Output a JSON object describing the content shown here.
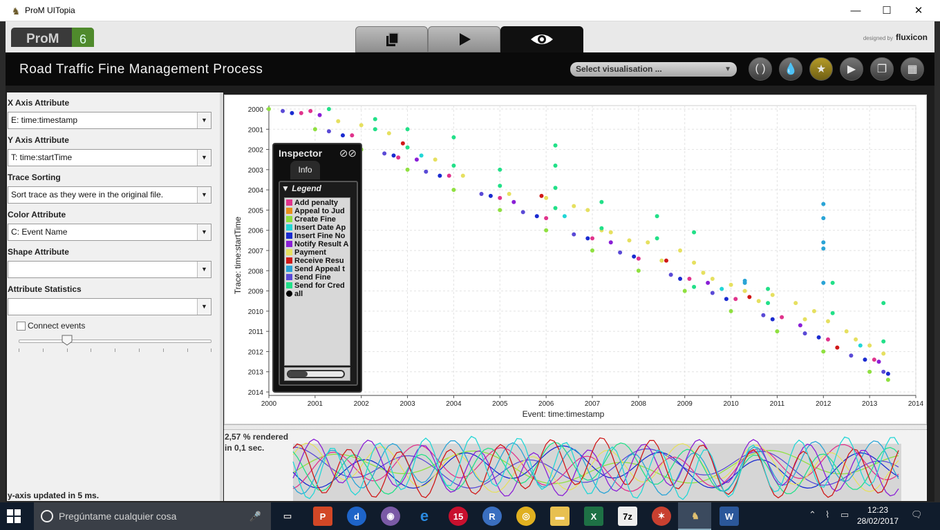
{
  "window": {
    "title": "ProM UITopia",
    "minimize": "—",
    "maximize": "☐",
    "close": "✕"
  },
  "header": {
    "logo_text": "ProM",
    "logo_version": "6",
    "designed_by": "designed by",
    "brand": "fluxicon",
    "tabs": [
      {
        "name": "workspace",
        "icon": "copy-icon",
        "active": false
      },
      {
        "name": "actions",
        "icon": "play-icon",
        "active": false
      },
      {
        "name": "view",
        "icon": "eye-icon",
        "active": true
      }
    ]
  },
  "toolbar": {
    "process_title": "Road Traffic Fine Management Process",
    "visualisation_select": "Select visualisation ...",
    "buttons": [
      {
        "icon": "refresh-icon",
        "active": false
      },
      {
        "icon": "drop-icon",
        "active": false
      },
      {
        "icon": "star-icon",
        "active": true
      },
      {
        "icon": "play-icon",
        "active": false
      },
      {
        "icon": "copy-icon",
        "active": false
      },
      {
        "icon": "grid-icon",
        "active": false
      }
    ]
  },
  "left_panel": {
    "x_axis_label": "X Axis Attribute",
    "x_axis_value": "E: time:timestamp",
    "y_axis_label": "Y Axis Attribute",
    "y_axis_value": "T: time:startTime",
    "trace_sorting_label": "Trace Sorting",
    "trace_sorting_value": "Sort trace as they were in the original file.",
    "color_label": "Color Attribute",
    "color_value": "C: Event Name",
    "shape_label": "Shape Attribute",
    "shape_value": "",
    "stats_label": "Attribute Statistics",
    "stats_value": "",
    "connect_events_label": "Connect events",
    "connect_events_checked": false,
    "slider_level": 0.25,
    "status": "y-axis updated in 5 ms."
  },
  "overview": {
    "rendered_pct": "2,57 % rendered",
    "rendered_time": "in 0,1 sec."
  },
  "inspector": {
    "title": "Inspector",
    "tab": "Info",
    "legend_title": "Legend",
    "legend_items": [
      {
        "label": "Add penalty",
        "color": "#e0338c"
      },
      {
        "label": "Appeal to Jud",
        "color": "#e8901a"
      },
      {
        "label": "Create Fine",
        "color": "#8fe040"
      },
      {
        "label": "Insert Date Ap",
        "color": "#22d6d6"
      },
      {
        "label": "Insert Fine No",
        "color": "#1a2bd0"
      },
      {
        "label": "Notify Result A",
        "color": "#8a1fd6"
      },
      {
        "label": "Payment",
        "color": "#e6e060"
      },
      {
        "label": "Receive Resu",
        "color": "#d01818"
      },
      {
        "label": "Send Appeal t",
        "color": "#2aa4d6"
      },
      {
        "label": "Send Fine",
        "color": "#5a4ad6"
      },
      {
        "label": "Send for Cred",
        "color": "#22e088"
      },
      {
        "label": "all",
        "color": "#000000",
        "round": true
      }
    ],
    "scroll_position": 0.33
  },
  "chart_data": {
    "type": "scatter",
    "title": "",
    "xlabel": "Event: time:timestamp",
    "ylabel": "Trace: time:startTime",
    "x_ticks": [
      "2000",
      "2001",
      "2002",
      "2003",
      "2004",
      "2005",
      "2006",
      "2007",
      "2008",
      "2009",
      "2010",
      "2011",
      "2012",
      "2013",
      "2014"
    ],
    "y_ticks": [
      "2000",
      "2001",
      "2002",
      "2003",
      "2004",
      "2005",
      "2006",
      "2007",
      "2008",
      "2009",
      "2010",
      "2011",
      "2012",
      "2013",
      "2014"
    ],
    "xlim": [
      2000,
      2014
    ],
    "ylim": [
      2000,
      2014
    ],
    "y_inverted": true,
    "grid": true,
    "series": [
      {
        "name": "Create Fine",
        "color": "#8fe040",
        "points": [
          [
            2000.0,
            2000.0
          ],
          [
            2001.0,
            2001.0
          ],
          [
            2002.0,
            2002.0
          ],
          [
            2003.0,
            2003.0
          ],
          [
            2004.0,
            2004.0
          ],
          [
            2005.0,
            2005.0
          ],
          [
            2006.0,
            2006.0
          ],
          [
            2007.0,
            2007.0
          ],
          [
            2008.0,
            2008.0
          ],
          [
            2009.0,
            2009.0
          ],
          [
            2010.0,
            2010.0
          ],
          [
            2011.0,
            2011.0
          ],
          [
            2012.0,
            2012.0
          ],
          [
            2013.0,
            2013.0
          ],
          [
            2013.4,
            2013.4
          ]
        ]
      },
      {
        "name": "Send Fine",
        "color": "#5a4ad6",
        "points": [
          [
            2000.3,
            2000.1
          ],
          [
            2001.3,
            2001.1
          ],
          [
            2002.5,
            2002.2
          ],
          [
            2003.4,
            2003.1
          ],
          [
            2004.6,
            2004.2
          ],
          [
            2005.5,
            2005.1
          ],
          [
            2006.6,
            2006.2
          ],
          [
            2007.6,
            2007.1
          ],
          [
            2008.7,
            2008.2
          ],
          [
            2009.6,
            2009.1
          ],
          [
            2010.7,
            2010.2
          ],
          [
            2011.6,
            2011.1
          ],
          [
            2012.6,
            2012.2
          ],
          [
            2013.3,
            2013.0
          ]
        ]
      },
      {
        "name": "Insert Fine Notification",
        "color": "#1a2bd0",
        "points": [
          [
            2000.5,
            2000.2
          ],
          [
            2001.6,
            2001.3
          ],
          [
            2002.7,
            2002.3
          ],
          [
            2003.7,
            2003.3
          ],
          [
            2004.8,
            2004.3
          ],
          [
            2005.8,
            2005.3
          ],
          [
            2006.9,
            2006.4
          ],
          [
            2007.9,
            2007.3
          ],
          [
            2008.9,
            2008.4
          ],
          [
            2009.9,
            2009.4
          ],
          [
            2010.9,
            2010.4
          ],
          [
            2011.9,
            2011.3
          ],
          [
            2012.9,
            2012.4
          ],
          [
            2013.4,
            2013.1
          ]
        ]
      },
      {
        "name": "Add penalty",
        "color": "#e0338c",
        "points": [
          [
            2000.7,
            2000.2
          ],
          [
            2001.8,
            2001.3
          ],
          [
            2002.8,
            2002.4
          ],
          [
            2003.9,
            2003.3
          ],
          [
            2005.0,
            2004.4
          ],
          [
            2006.0,
            2005.4
          ],
          [
            2007.0,
            2006.4
          ],
          [
            2008.0,
            2007.4
          ],
          [
            2009.1,
            2008.4
          ],
          [
            2010.1,
            2009.4
          ],
          [
            2011.1,
            2010.3
          ],
          [
            2012.1,
            2011.4
          ],
          [
            2013.1,
            2012.4
          ],
          [
            2000.9,
            2000.1
          ]
        ]
      },
      {
        "name": "Payment",
        "color": "#e6e060",
        "points": [
          [
            2001.5,
            2000.6
          ],
          [
            2002.0,
            2000.8
          ],
          [
            2002.6,
            2001.2
          ],
          [
            2003.6,
            2002.5
          ],
          [
            2004.2,
            2003.3
          ],
          [
            2005.2,
            2004.2
          ],
          [
            2006.0,
            2004.4
          ],
          [
            2006.6,
            2004.8
          ],
          [
            2006.9,
            2005.0
          ],
          [
            2007.4,
            2006.1
          ],
          [
            2007.8,
            2006.5
          ],
          [
            2008.2,
            2006.6
          ],
          [
            2008.9,
            2007.0
          ],
          [
            2009.2,
            2007.6
          ],
          [
            2009.6,
            2008.4
          ],
          [
            2010.0,
            2008.7
          ],
          [
            2010.3,
            2009.0
          ],
          [
            2010.9,
            2009.2
          ],
          [
            2011.4,
            2009.6
          ],
          [
            2011.8,
            2010.0
          ],
          [
            2012.1,
            2010.5
          ],
          [
            2012.7,
            2011.4
          ],
          [
            2013.0,
            2011.7
          ],
          [
            2013.3,
            2012.1
          ],
          [
            2012.5,
            2011.0
          ],
          [
            2011.6,
            2010.4
          ],
          [
            2010.6,
            2009.5
          ],
          [
            2009.4,
            2008.1
          ],
          [
            2008.5,
            2007.5
          ],
          [
            2007.2,
            2006.0
          ]
        ]
      },
      {
        "name": "Send for Credit Collection",
        "color": "#22e088",
        "points": [
          [
            2001.3,
            2000.0
          ],
          [
            2002.3,
            2000.5
          ],
          [
            2002.3,
            2001.0
          ],
          [
            2003.0,
            2001.0
          ],
          [
            2003.0,
            2001.9
          ],
          [
            2004.0,
            2001.4
          ],
          [
            2004.0,
            2002.8
          ],
          [
            2005.0,
            2003.0
          ],
          [
            2005.0,
            2003.8
          ],
          [
            2006.2,
            2001.8
          ],
          [
            2006.2,
            2002.8
          ],
          [
            2006.2,
            2003.9
          ],
          [
            2006.2,
            2004.9
          ],
          [
            2007.2,
            2004.6
          ],
          [
            2007.2,
            2005.9
          ],
          [
            2008.4,
            2005.3
          ],
          [
            2008.4,
            2006.4
          ],
          [
            2009.2,
            2006.1
          ],
          [
            2009.2,
            2008.8
          ],
          [
            2010.8,
            2008.9
          ],
          [
            2010.8,
            2009.6
          ],
          [
            2012.2,
            2008.6
          ],
          [
            2012.2,
            2010.1
          ],
          [
            2013.3,
            2009.6
          ],
          [
            2013.3,
            2011.5
          ]
        ]
      },
      {
        "name": "Send Appeal to Prefecture",
        "color": "#2aa4d6",
        "points": [
          [
            2012.0,
            2004.7
          ],
          [
            2012.0,
            2005.4
          ],
          [
            2012.0,
            2006.6
          ],
          [
            2012.0,
            2006.9
          ],
          [
            2012.0,
            2008.6
          ],
          [
            2010.3,
            2008.5
          ],
          [
            2010.3,
            2008.6
          ]
        ]
      },
      {
        "name": "Notify Result Appeal",
        "color": "#8a1fd6",
        "points": [
          [
            2001.1,
            2000.3
          ],
          [
            2003.2,
            2002.5
          ],
          [
            2005.3,
            2004.6
          ],
          [
            2007.4,
            2006.6
          ],
          [
            2009.5,
            2008.6
          ],
          [
            2011.5,
            2010.7
          ],
          [
            2013.2,
            2012.5
          ]
        ]
      },
      {
        "name": "Receive Result",
        "color": "#d01818",
        "points": [
          [
            2002.9,
            2001.7
          ],
          [
            2005.9,
            2004.3
          ],
          [
            2008.6,
            2007.5
          ],
          [
            2010.4,
            2009.3
          ],
          [
            2012.3,
            2011.8
          ]
        ]
      },
      {
        "name": "Insert Date Appeal",
        "color": "#22d6d6",
        "points": [
          [
            2003.3,
            2002.3
          ],
          [
            2006.4,
            2005.3
          ],
          [
            2009.8,
            2008.9
          ],
          [
            2012.8,
            2011.7
          ]
        ]
      }
    ]
  }
}
